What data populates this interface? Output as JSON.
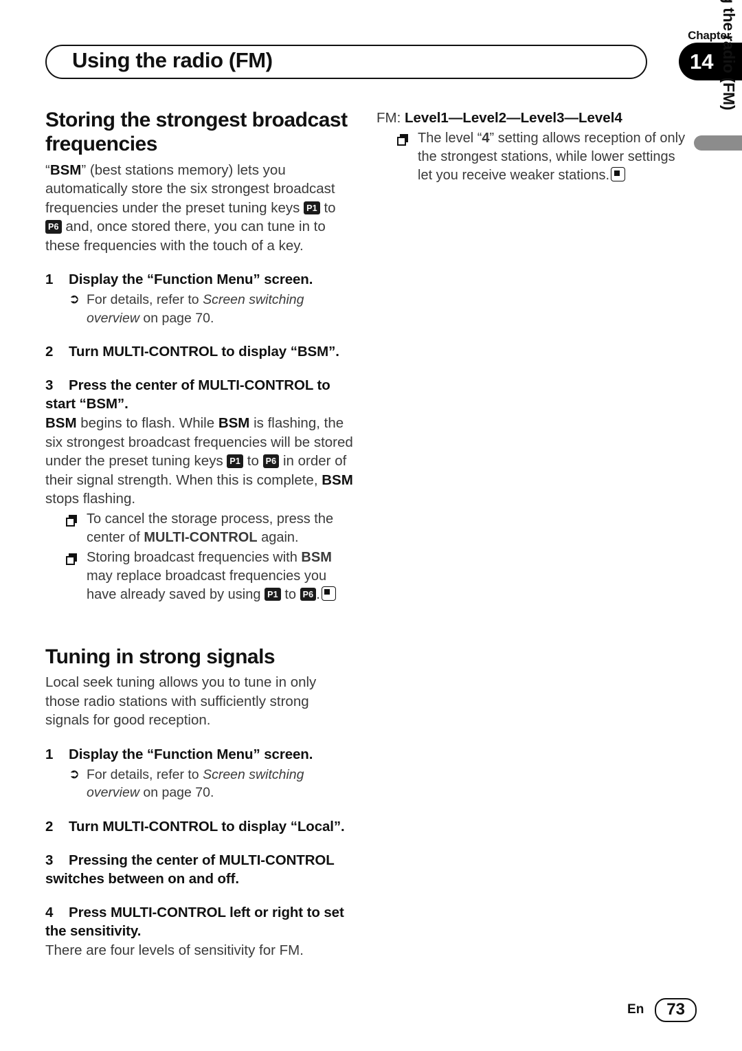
{
  "header": {
    "chapter_label": "Chapter",
    "chapter_number": "14",
    "title": "Using the radio (FM)"
  },
  "side_tab": {
    "label": "Using the radio (FM)",
    "bar_color": "#8c8c8c"
  },
  "left_column": {
    "section1": {
      "heading": "Storing the strongest broadcast frequencies",
      "intro_part1": "“",
      "intro_bsm": "BSM",
      "intro_part2": "” (best stations memory) lets you automatically store the six strongest broadcast frequencies under the preset tuning keys ",
      "key_p1": "P1",
      "intro_to": " to ",
      "key_p6": "P6",
      "intro_part3": " and, once stored there, you can tune in to these frequencies with the touch of a key.",
      "steps": [
        {
          "number": "1",
          "head": "Display the “Function Menu” screen.",
          "refer_prefix": "For details, refer to ",
          "refer_italic": "Screen switching overview",
          "refer_suffix": " on page 70."
        },
        {
          "number": "2",
          "head": "Turn MULTI-CONTROL to display “BSM”."
        },
        {
          "number": "3",
          "head": "Press the center of MULTI-CONTROL to start “BSM”."
        }
      ],
      "step3_body": {
        "b1": "BSM",
        "t1": " begins to flash. While ",
        "b2": "BSM",
        "t2": " is flashing, the six strongest broadcast frequencies will be stored under the preset tuning keys ",
        "key_p1": "P1",
        "t3": " to ",
        "key_p6": "P6",
        "t4": " in order of their signal strength. When this is complete, ",
        "b3": "BSM",
        "t5": " stops flashing."
      },
      "notes": [
        {
          "t1": "To cancel the storage process, press the center of ",
          "b1": "MULTI-CONTROL",
          "t2": " again."
        },
        {
          "t1": "Storing broadcast frequencies with ",
          "b1": "BSM",
          "t2": " may replace broadcast frequencies you have already saved by using ",
          "key_p1": "P1",
          "t3": " to ",
          "key_p6": "P6",
          "t4": "."
        }
      ]
    },
    "section2": {
      "heading": "Tuning in strong signals",
      "intro": "Local seek tuning allows you to tune in only those radio stations with sufficiently strong signals for good reception.",
      "steps": [
        {
          "number": "1",
          "head": "Display the “Function Menu” screen.",
          "refer_prefix": "For details, refer to ",
          "refer_italic": "Screen switching overview",
          "refer_suffix": " on page 70."
        },
        {
          "number": "2",
          "head": "Turn MULTI-CONTROL to display “Local”."
        },
        {
          "number": "3",
          "head": "Pressing the center of MULTI-CONTROL switches between on and off."
        },
        {
          "number": "4",
          "head": "Press MULTI-CONTROL left or right to set the sensitivity.",
          "body": "There are four levels of sensitivity for FM."
        }
      ]
    }
  },
  "right_column": {
    "levels": {
      "prefix": "FM: ",
      "level1": "Level1",
      "sep": "—",
      "level2": "Level2",
      "level3": "Level3",
      "level4": "Level4"
    },
    "note": {
      "t1": "The level “",
      "b1": "4",
      "t2": "” setting allows reception of only the strongest stations, while lower settings let you receive weaker stations."
    }
  },
  "footer": {
    "language": "En",
    "page_number": "73"
  },
  "icons": {
    "refer_arrow": "➲",
    "note_bullet": "shadow-square-icon",
    "end_mark": "filled-square-in-box-icon"
  }
}
